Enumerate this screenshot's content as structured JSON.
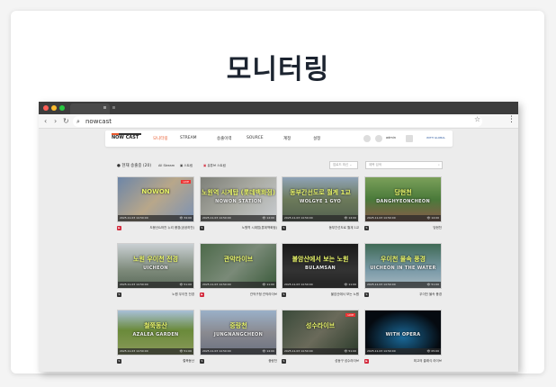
{
  "page_title": "모니터링",
  "browser": {
    "url": "nowcast"
  },
  "nav": {
    "logo": "NOW CAST",
    "items": [
      "모니터링",
      "STREAM",
      "송출이력",
      "SOURCE",
      "계정",
      "설정"
    ],
    "user": "admin",
    "brand_label": "WITH GLOBAL"
  },
  "toolbar": {
    "section": "현재 송출중 (20)",
    "all_stream": "All Stream",
    "stream": "스트림",
    "youtube_stream": "유튜브 스트림",
    "sort": "업로드 최신",
    "search_placeholder": "제목 검색"
  },
  "accent": "#e8572a",
  "cards": [
    {
      "title": "도봉산&하천 누리 풍경(공공하천)",
      "date": "2025.11.03 14:50:00",
      "views": "34:00",
      "overlay": "NOWON",
      "overlay2": "",
      "badge": "youtube",
      "bg": "linear-gradient(135deg,#6d86a8,#b8a78a 50%,#7b92b5)",
      "live": true
    },
    {
      "title": "노원역 시계탑(롯데백화점)",
      "date": "2025.11.03 14:50:00",
      "views": "14:00",
      "overlay": "노원역 시계탑\n(롯데백화점)",
      "overlay2": "NOWON STATION",
      "badge": "stream",
      "bg": "linear-gradient(135deg,#7d7f78,#a9aaa2 50%,#c8ccd0)"
    },
    {
      "title": "동부간선도로 월계 1교",
      "date": "2025.11.03 14:50:00",
      "views": "14:00",
      "overlay": "동부간선도로 월계 1교",
      "overlay2": "WOLGYE 1 GYO",
      "badge": "stream",
      "bg": "linear-gradient(180deg,#8fa3b7,#6c7a5a 50%,#546150)"
    },
    {
      "title": "당현천",
      "date": "2025.11.03 14:50:00",
      "views": "14:00",
      "overlay": "당현천",
      "overlay2": "DANGHYEONCHEON",
      "badge": "stream",
      "bg": "linear-gradient(180deg,#7ba05a,#4a7a3a 50%,#8a5a4a)"
    },
    {
      "title": "노원 우이천 전경",
      "date": "2025.11.03 14:50:00",
      "views": "51:00",
      "overlay": "노원 우이천 전경",
      "overlay2": "UICHEON",
      "badge": "stream",
      "bg": "linear-gradient(180deg,#c9cfd2,#7d8a7a 60%,#5a6a5a)"
    },
    {
      "title": "관악구청 관악라이브",
      "date": "2025.11.03 14:50:00",
      "views": "11:00",
      "overlay": "관악라이브",
      "overlay2": "",
      "badge": "youtube",
      "bg": "linear-gradient(135deg,#4d6a4a,#7a8a78 50%,#3a5a3a)"
    },
    {
      "title": "불암산에서 보는 노원",
      "date": "2025.11.03 14:50:00",
      "views": "11:00",
      "overlay": "불암산에서 보는 노원",
      "overlay2": "BULAMSAN",
      "badge": "stream",
      "bg": "linear-gradient(180deg,#1a1a1a,#333 60%,#222)"
    },
    {
      "title": "우이천 물속 풍경",
      "date": "2025.11.03 14:50:00",
      "views": "51:00",
      "overlay": "우이천 물속 풍경",
      "overlay2": "UICHEON IN THE WATER",
      "badge": "stream",
      "bg": "linear-gradient(180deg,#3f6a55,#7a9aa8 60%,#a8b8c0)"
    },
    {
      "title": "철쭉동산",
      "date": "2025.11.03 14:50:00",
      "views": "51:00",
      "overlay": "철쭉동산",
      "overlay2": "AZALEA GARDEN",
      "badge": "stream",
      "bg": "linear-gradient(180deg,#a8c0d8,#6a8a3a 45%,#8a9a5a)"
    },
    {
      "title": "중랑천",
      "date": "2025.11.03 14:50:00",
      "views": "14:00",
      "overlay": "중랑천",
      "overlay2": "JUNGNANGCHEON",
      "badge": "stream",
      "bg": "linear-gradient(180deg,#9ab0c8,#8a8a90 50%,#6a7080)"
    },
    {
      "title": "성동구 성수라이브",
      "date": "2025.11.03 14:50:00",
      "views": "51:00",
      "overlay": "성수라이브",
      "overlay2": "",
      "badge": "stream",
      "bg": "linear-gradient(135deg,#3a4a3a,#6a6a5a 50%,#2a3a2a)",
      "live": true
    },
    {
      "title": "최고의 클래식 라이브",
      "date": "2025.11.03 14:50:00",
      "views": "05:00",
      "overlay": "",
      "overlay2": "WITH OPERA",
      "badge": "youtube",
      "bg": "radial-gradient(ellipse at 50% 60%,#1a6a9a,#050a10 70%)"
    }
  ]
}
